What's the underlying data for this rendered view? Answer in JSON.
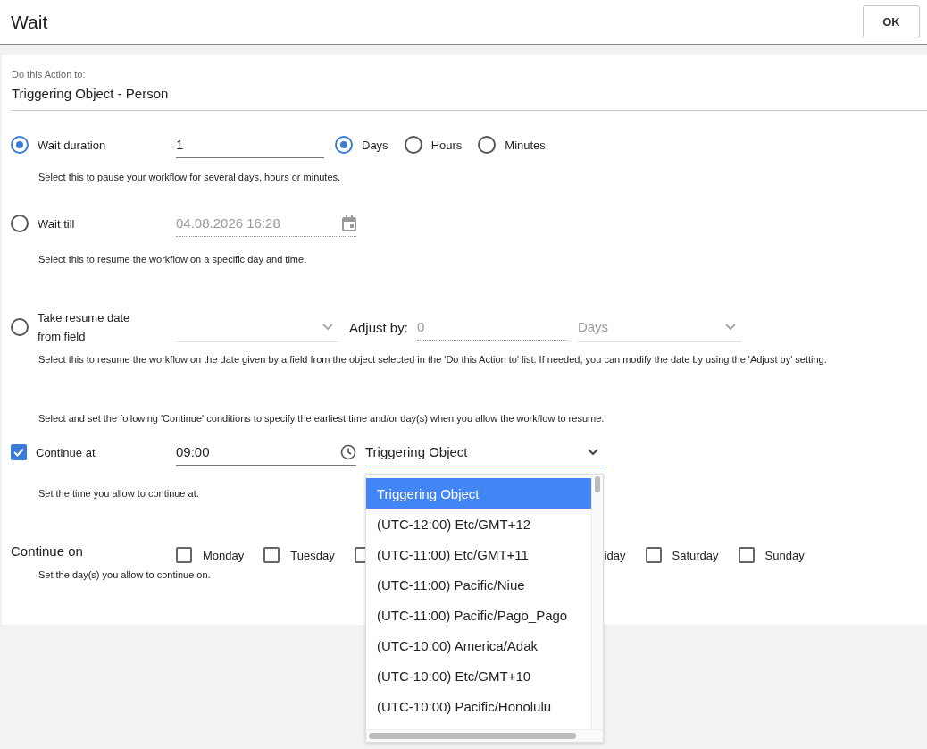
{
  "window": {
    "title": "Wait"
  },
  "ok_button": "OK",
  "target": {
    "label": "Do this Action to:",
    "value": "Triggering Object - Person"
  },
  "wait_options": [
    {
      "kind": "duration",
      "label": "Wait duration",
      "selected": true,
      "value": "1",
      "units": [
        {
          "label": "Days",
          "selected": true
        },
        {
          "label": "Hours",
          "selected": false
        },
        {
          "label": "Minutes",
          "selected": false
        }
      ],
      "description": "Select this to pause your workflow for several days, hours or minutes."
    },
    {
      "kind": "till",
      "label": "Wait till",
      "selected": false,
      "placeholder": "04.08.2026 16:28",
      "description": "Select this to resume the workflow on a specific day and time."
    },
    {
      "kind": "field",
      "label": "Take resume date from field",
      "selected": false,
      "adjust_label": "Adjust by:",
      "adjust_placeholder": "0",
      "adjust_unit": "Days",
      "description": "Select this to resume the workflow on the date given by a field from the object selected in the 'Do this Action to' list. If needed, you can modify the date by using the 'Adjust by' setting."
    }
  ],
  "continue_note": "Select and set the following 'Continue' conditions to specify the earliest time and/or day(s) when you allow the workflow to resume.",
  "continue_at": {
    "label": "Continue at",
    "checked": true,
    "time": "09:00",
    "timezone": "Triggering Object",
    "description": "Set the time you allow to continue at."
  },
  "continue_on": {
    "label": "Continue on",
    "description": "Set the day(s) you allow to continue on.",
    "days": [
      {
        "kind": "day",
        "label": "Monday",
        "checked": false
      },
      {
        "kind": "day",
        "label": "Tuesday",
        "checked": false
      },
      {
        "kind": "covered",
        "checked": false
      },
      {
        "kind": "clipped",
        "label": "iday"
      },
      {
        "kind": "day",
        "label": "Saturday",
        "checked": false
      },
      {
        "kind": "day",
        "label": "Sunday",
        "checked": false
      }
    ]
  },
  "timezone_dropdown": {
    "options": [
      {
        "label": "Triggering Object",
        "selected": true
      },
      {
        "label": "(UTC-12:00) Etc/GMT+12",
        "selected": false
      },
      {
        "label": "(UTC-11:00) Etc/GMT+11",
        "selected": false
      },
      {
        "label": "(UTC-11:00) Pacific/Niue",
        "selected": false
      },
      {
        "label": "(UTC-11:00) Pacific/Pago_Pago",
        "selected": false
      },
      {
        "label": "(UTC-10:00) America/Adak",
        "selected": false
      },
      {
        "label": "(UTC-10:00) Etc/GMT+10",
        "selected": false
      },
      {
        "label": "(UTC-10:00) Pacific/Honolulu",
        "selected": false
      }
    ]
  }
}
